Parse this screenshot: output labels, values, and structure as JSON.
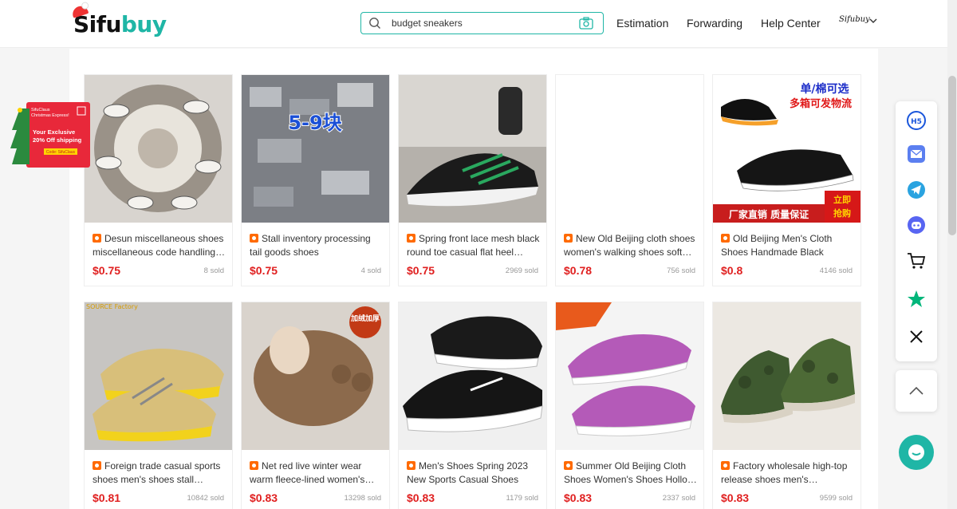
{
  "header": {
    "logo_part1": "Sifu",
    "logo_part2": "buy",
    "search_value": "budget sneakers",
    "nav": [
      "Estimation",
      "Forwarding",
      "Help Center"
    ],
    "avatar_text": "Sifubuy"
  },
  "promo": {
    "line1": "SifuClaus",
    "line2": "Christmas Express!",
    "line3": "Your Exclusive",
    "line4": "20% Off shipping",
    "code": "Code: SifuClaus"
  },
  "products": [
    {
      "title": "Desun miscellaneous shoes miscellaneous code handling…",
      "price": "$0.75",
      "sold": "8 sold"
    },
    {
      "title": "Stall inventory processing tail goods shoes manufacture…",
      "price": "$0.75",
      "sold": "4 sold",
      "overlay": "5-9块"
    },
    {
      "title": "Spring front lace mesh black round toe casual flat heel…",
      "price": "$0.75",
      "sold": "2969 sold"
    },
    {
      "title": "New Old Beijing cloth shoes women's walking shoes soft…",
      "price": "$0.78",
      "sold": "756 sold"
    },
    {
      "title": "Old Beijing Men's Cloth Shoes Handmade Black Cloth…",
      "price": "$0.8",
      "sold": "4146 sold",
      "overlay_top1": "单/棉可选",
      "overlay_top2": "多箱可发物流",
      "overlay_bottom": "厂家直销 质量保证",
      "overlay_badge1": "立即",
      "overlay_badge2": "抢购"
    },
    {
      "title": "Foreign trade casual sports shoes men's shoes stall…",
      "price": "$0.81",
      "sold": "10842 sold",
      "overlay": "SOURCE Factory"
    },
    {
      "title": "Net red live winter wear warm fleece-lined women's…",
      "price": "$0.83",
      "sold": "13298 sold",
      "overlay": "加绒加厚"
    },
    {
      "title": "Men's Shoes Spring 2023 New Sports Casual Shoes All-…",
      "price": "$0.83",
      "sold": "1179 sold"
    },
    {
      "title": "Summer Old Beijing Cloth Shoes Women's Shoes Hollo…",
      "price": "$0.83",
      "sold": "2337 sold"
    },
    {
      "title": "Factory wholesale high-top release shoes men's…",
      "price": "$0.83",
      "sold": "9599 sold"
    }
  ],
  "toolbar": {
    "h5_label": "H5"
  },
  "colors": {
    "brand": "#1fb6a6",
    "price": "#e02020",
    "icon_orange": "#ff6a00"
  }
}
